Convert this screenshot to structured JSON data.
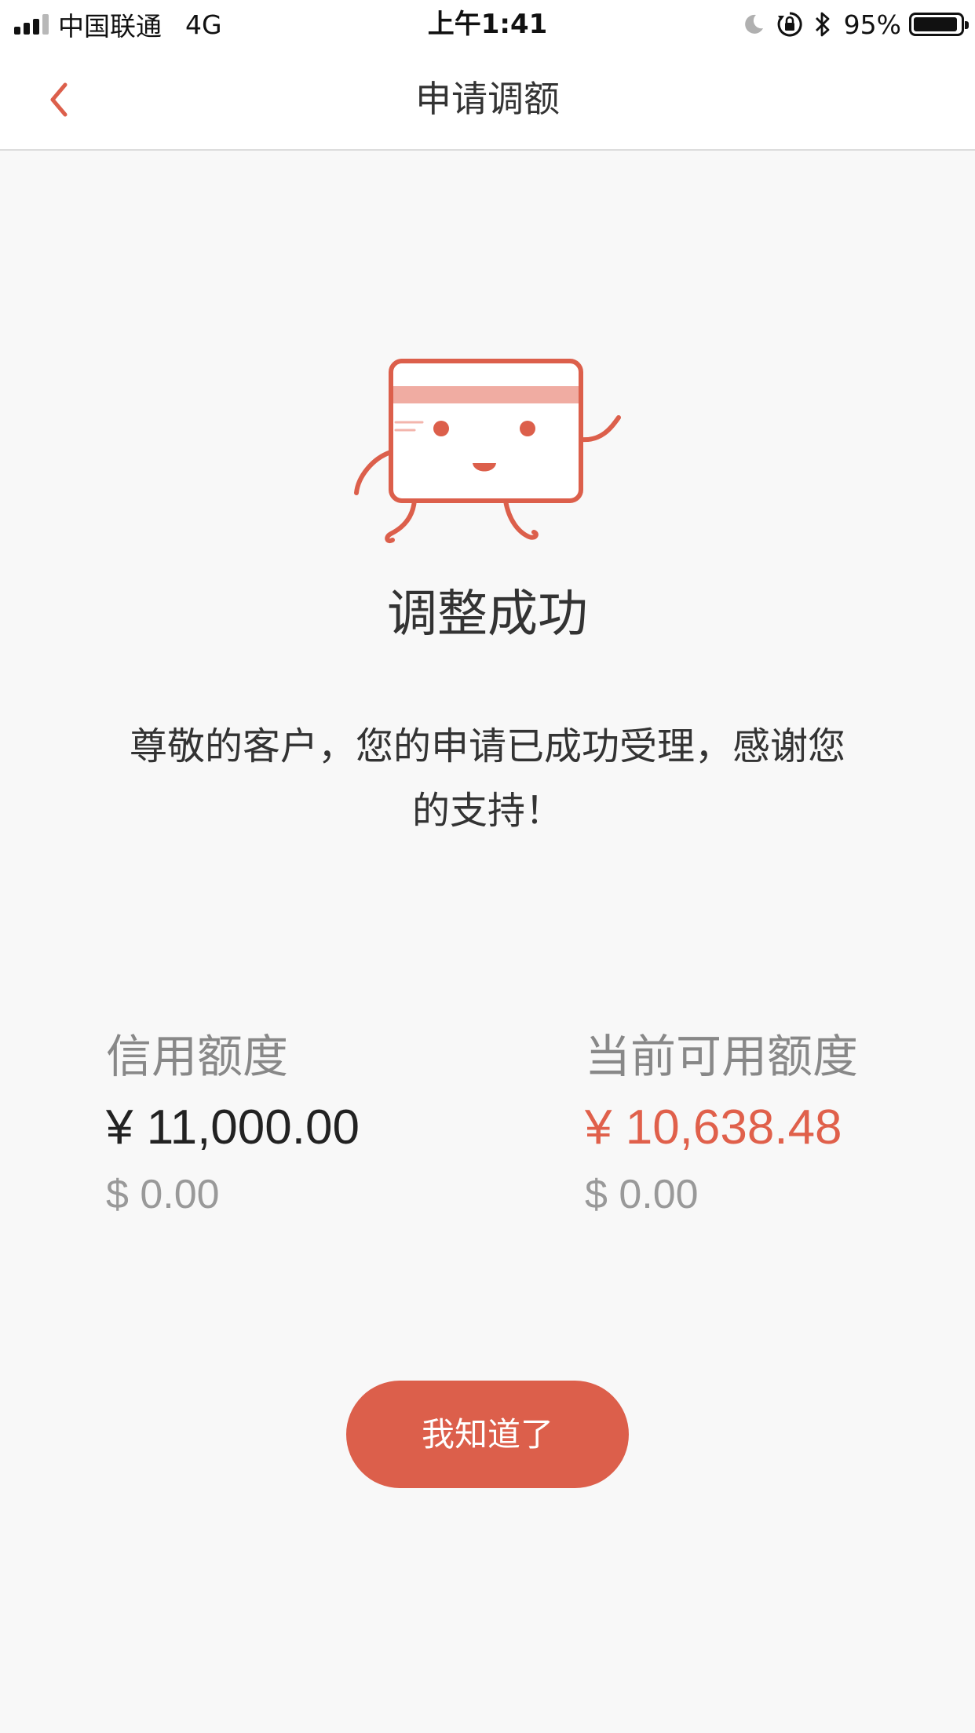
{
  "status_bar": {
    "carrier": "中国联通",
    "network": "4G",
    "time": "上午1:41",
    "battery_percent": "95%",
    "battery_level": 0.95,
    "icons": [
      "moon-icon",
      "orientation-lock-icon",
      "bluetooth-icon"
    ]
  },
  "nav": {
    "title": "申请调额",
    "back_icon": "chevron-left-icon"
  },
  "result": {
    "title": "调整成功",
    "message": "尊敬的客户，您的申请已成功受理，感谢您的支持！"
  },
  "limits": {
    "credit": {
      "label": "信用额度",
      "cny": "¥ 11,000.00",
      "usd": "$ 0.00"
    },
    "available": {
      "label": "当前可用额度",
      "cny": "¥ 10,638.48",
      "usd": "$ 0.00"
    }
  },
  "button": {
    "label": "我知道了"
  },
  "colors": {
    "accent": "#dc5f4b",
    "background": "#f8f8f8"
  }
}
